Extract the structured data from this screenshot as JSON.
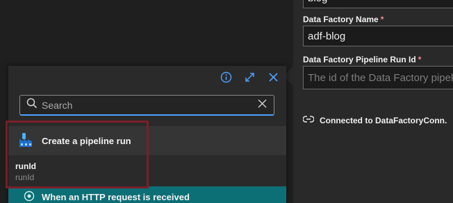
{
  "right_panel": {
    "top_field_value": "blog",
    "factory_name": {
      "label": "Data Factory Name",
      "required": "*",
      "value": "adf-blog"
    },
    "run_id": {
      "label": "Data Factory Pipeline Run Id",
      "required": "*",
      "placeholder": "The id of the Data Factory pipeline run"
    },
    "connection": {
      "text": "Connected to DataFactoryConn."
    }
  },
  "popup": {
    "icons": [
      "info-icon",
      "expand-icon",
      "close-icon"
    ],
    "search": {
      "placeholder": "Search",
      "value": ""
    },
    "action": {
      "label": "Create a pipeline run",
      "icon": "data-factory-icon"
    },
    "outputs": [
      {
        "name": "runId",
        "subtitle": "runId"
      }
    ],
    "trigger": {
      "label": "When an HTTP request is received",
      "icon": "http-request-icon"
    }
  },
  "colors": {
    "accent": "#4fa3ff",
    "highlight": "#7a1f27",
    "trigger_bg": "#0d6f76"
  }
}
